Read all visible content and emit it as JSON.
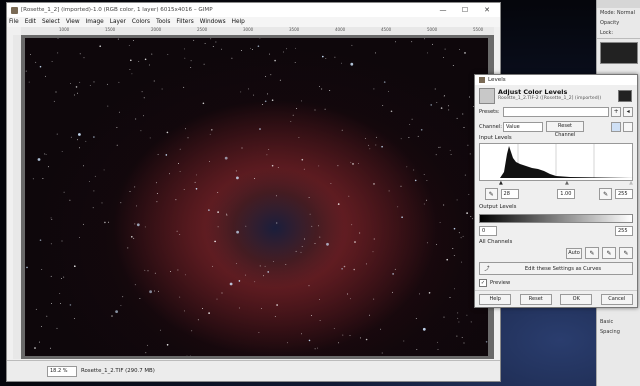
{
  "window": {
    "title": "[Rosette_1_2] (imported)-1.0 (RGB color, 1 layer) 6015x4016 – GIMP",
    "controls": {
      "minimize": "—",
      "maximize": "☐",
      "close": "✕"
    }
  },
  "menu": [
    "File",
    "Edit",
    "Select",
    "View",
    "Image",
    "Layer",
    "Colors",
    "Tools",
    "Filters",
    "Windows",
    "Help"
  ],
  "ruler": {
    "h_ticks": [
      "1000",
      "1500",
      "2000",
      "2500",
      "3000",
      "3500",
      "4000",
      "4500",
      "5000",
      "5500"
    ]
  },
  "status": {
    "zoom": "18.2 %",
    "text": "Rosette_1_2.TIF (290.7 MB)"
  },
  "dock": {
    "mode_label": "Mode: Normal",
    "opacity_label": "Opacity",
    "lock_label": "Lock:",
    "tool_option": "Basic",
    "spacing_label": "Spacing"
  },
  "levels": {
    "title": "Levels",
    "heading": "Adjust Color Levels",
    "subheading": "Rosette_1_2.TIF-2 ([Rosette_1_2] (imported))",
    "presets_label": "Presets:",
    "channel_label": "Channel:",
    "channel_value": "Value",
    "reset_channel": "Reset Channel",
    "input_levels": "Input Levels",
    "input_low": "28",
    "input_gamma": "1.00",
    "input_high": "255",
    "output_levels": "Output Levels",
    "output_low": "0",
    "output_high": "255",
    "all_channels": "All Channels",
    "auto": "Auto",
    "edit_curves": "Edit these Settings as Curves",
    "preview": "Preview",
    "buttons": {
      "help": "Help",
      "reset": "Reset",
      "ok": "OK",
      "cancel": "Cancel"
    }
  }
}
